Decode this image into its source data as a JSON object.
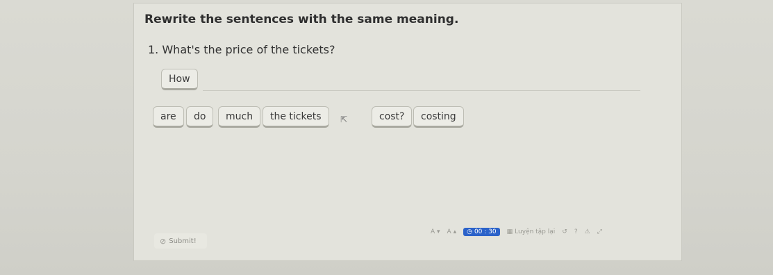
{
  "instruction": "Rewrite the sentences with the same meaning.",
  "question": "1. What's the price of the tickets?",
  "answer_chips": [
    "How"
  ],
  "word_bank": [
    "are",
    "do",
    "much",
    "the tickets",
    "cost?",
    "costing"
  ],
  "submit_label": "Submit!",
  "footer": {
    "font_decrease": "A ▾",
    "font_increase": "A ▴",
    "timer": "00 : 30",
    "practice_label": "Luyện tập lại",
    "undo_icon": "undo-icon",
    "help_icon": "help-icon",
    "warning_icon": "warning-icon",
    "expand_icon": "expand-icon"
  },
  "colors": {
    "timer_bg": "#2b62c9"
  }
}
